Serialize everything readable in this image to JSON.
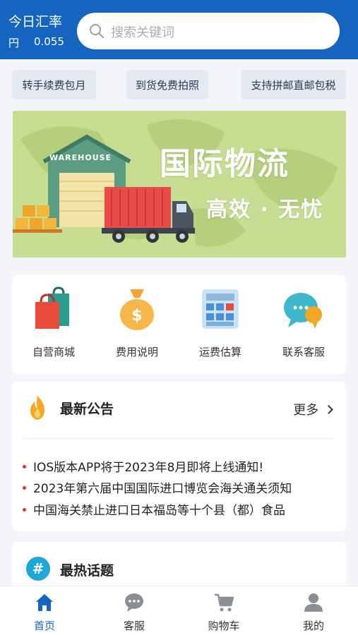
{
  "header": {
    "rate_title": "今日汇率",
    "rate_unit": "円",
    "rate_value": "0.055",
    "search_placeholder": "搜索关键词",
    "accent_color": "#1565c0"
  },
  "promos": [
    "转手续费包月",
    "到货免费拍照",
    "支持拼邮直邮包税"
  ],
  "banner": {
    "warehouse_label": "WAREHOUSE",
    "title": "国际物流",
    "subtitle": "高效 · 无忧"
  },
  "services": [
    {
      "label": "自营商城",
      "icon": "shopping-bag-icon"
    },
    {
      "label": "费用说明",
      "icon": "money-bag-icon"
    },
    {
      "label": "运费估算",
      "icon": "calculator-icon"
    },
    {
      "label": "联系客服",
      "icon": "chat-bubble-icon"
    }
  ],
  "announcements": {
    "title": "最新公告",
    "more": "更多",
    "items": [
      "IOS版本APP将于2023年8月即将上线通知!",
      "2023年第六届中国国际进口博览会海关通关须知",
      "中国海关禁止进口日本福岛等十个县（都）食品"
    ]
  },
  "hot_topics": {
    "title": "最热话题"
  },
  "tabbar": [
    {
      "label": "首页",
      "icon": "home-icon",
      "active": true
    },
    {
      "label": "客服",
      "icon": "chat-icon",
      "active": false
    },
    {
      "label": "购物车",
      "icon": "cart-icon",
      "active": false
    },
    {
      "label": "我的",
      "icon": "user-icon",
      "active": false
    }
  ]
}
